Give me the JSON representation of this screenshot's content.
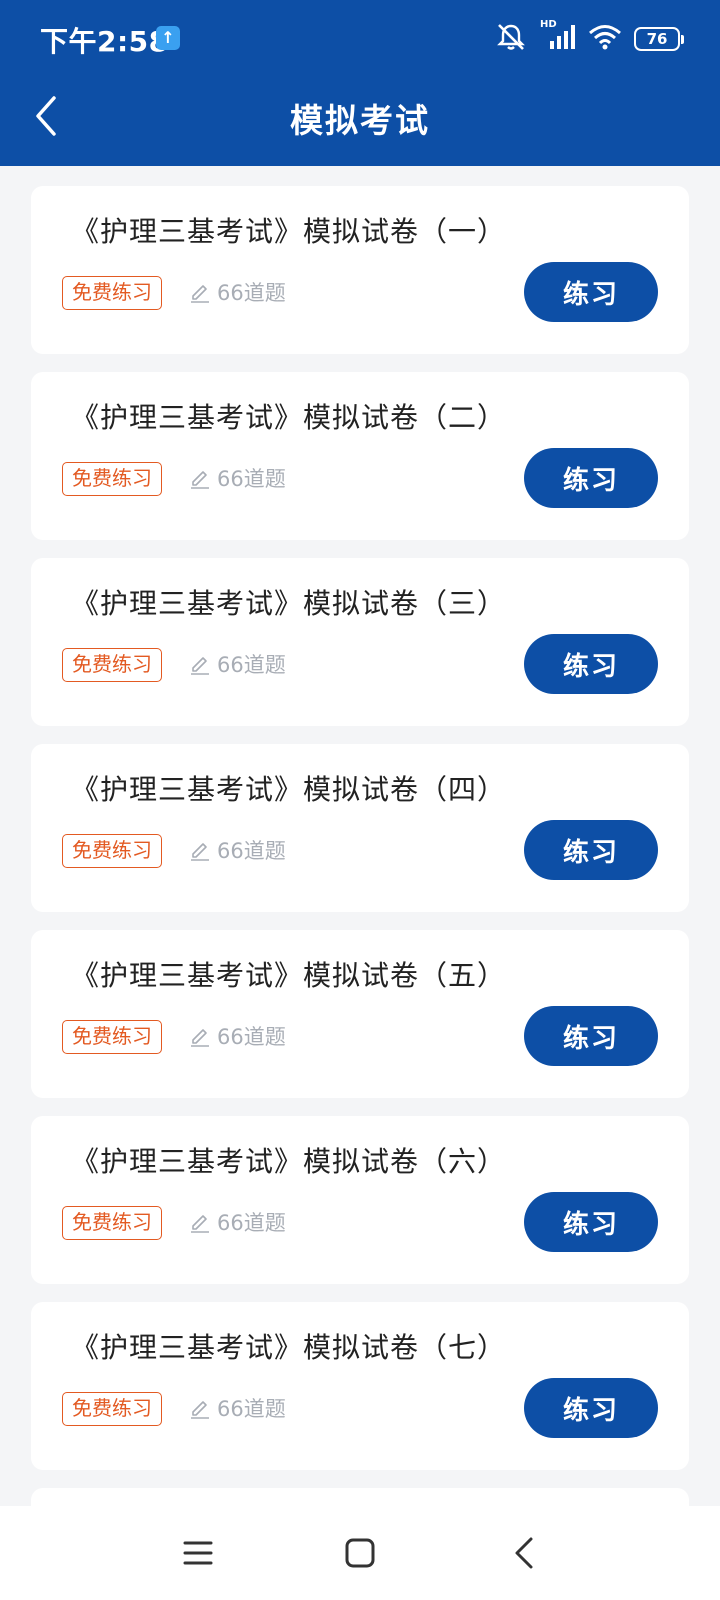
{
  "status_bar": {
    "time": "下午2:58",
    "upload_badge": "↑",
    "battery": "76",
    "network_label": "HD"
  },
  "header": {
    "title": "模拟考试"
  },
  "exams": [
    {
      "title": "《护理三基考试》模拟试卷（一）",
      "tag": "免费练习",
      "count": "66道题",
      "button": "练习"
    },
    {
      "title": "《护理三基考试》模拟试卷（二）",
      "tag": "免费练习",
      "count": "66道题",
      "button": "练习"
    },
    {
      "title": "《护理三基考试》模拟试卷（三）",
      "tag": "免费练习",
      "count": "66道题",
      "button": "练习"
    },
    {
      "title": "《护理三基考试》模拟试卷（四）",
      "tag": "免费练习",
      "count": "66道题",
      "button": "练习"
    },
    {
      "title": "《护理三基考试》模拟试卷（五）",
      "tag": "免费练习",
      "count": "66道题",
      "button": "练习"
    },
    {
      "title": "《护理三基考试》模拟试卷（六）",
      "tag": "免费练习",
      "count": "66道题",
      "button": "练习"
    },
    {
      "title": "《护理三基考试》模拟试卷（七）",
      "tag": "免费练习",
      "count": "66道题",
      "button": "练习"
    }
  ],
  "colors": {
    "primary": "#0d4fa6",
    "tag": "#e35a22",
    "muted": "#a8adb5",
    "background": "#f4f5f7"
  },
  "icons": {
    "back": "chevron-left-icon",
    "count": "pencil-icon",
    "menu": "menu-icon",
    "home": "home-icon",
    "sys_back": "back-icon"
  }
}
